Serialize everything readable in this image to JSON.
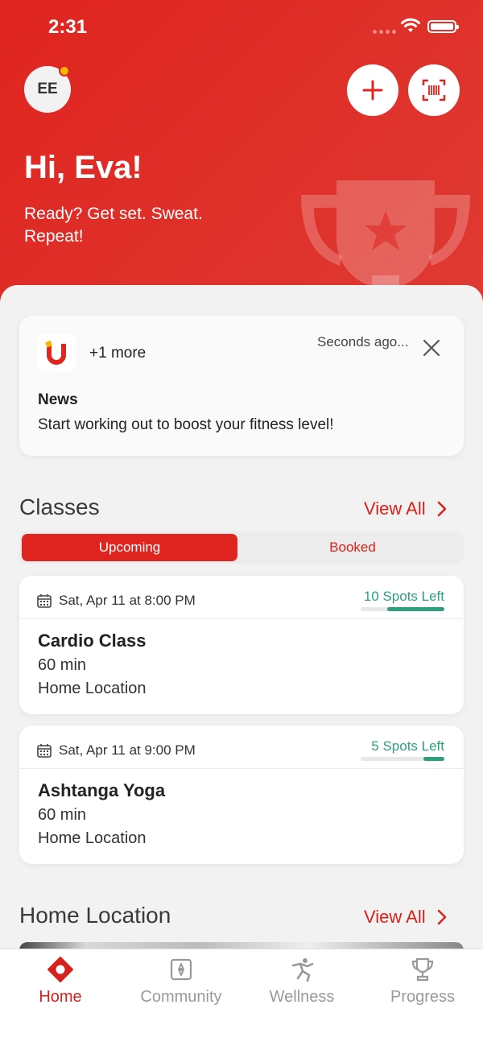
{
  "status_bar": {
    "time": "2:31"
  },
  "header": {
    "avatar_initials": "EE",
    "greeting": "Hi, Eva!",
    "tagline": "Ready? Get set. Sweat. Repeat!"
  },
  "notification": {
    "more": "+1 more",
    "time": "Seconds ago...",
    "heading": "News",
    "body": "Start working out to boost your fitness level!"
  },
  "classes": {
    "title": "Classes",
    "view_all": "View All",
    "tabs": [
      {
        "label": "Upcoming",
        "selected": true
      },
      {
        "label": "Booked",
        "selected": false
      }
    ],
    "items": [
      {
        "date": "Sat, Apr 11 at 8:00 PM",
        "spots": "10 Spots Left",
        "spots_fraction": 0.68,
        "name": "Cardio Class",
        "duration": "60 min",
        "location": "Home Location"
      },
      {
        "date": "Sat, Apr 11 at 9:00 PM",
        "spots": "5 Spots Left",
        "spots_fraction": 0.25,
        "name": "Ashtanga Yoga",
        "duration": "60 min",
        "location": "Home Location"
      }
    ]
  },
  "home_location": {
    "title": "Home Location",
    "view_all": "View All"
  },
  "tabbar": {
    "items": [
      {
        "label": "Home",
        "icon": "home-icon",
        "active": true
      },
      {
        "label": "Community",
        "icon": "community-icon",
        "active": false
      },
      {
        "label": "Wellness",
        "icon": "wellness-icon",
        "active": false
      },
      {
        "label": "Progress",
        "icon": "trophy-icon",
        "active": false
      }
    ]
  },
  "colors": {
    "brand_red": "#e0241f",
    "accent_green": "#2e9e7d",
    "notification_dot": "#f5b800"
  }
}
